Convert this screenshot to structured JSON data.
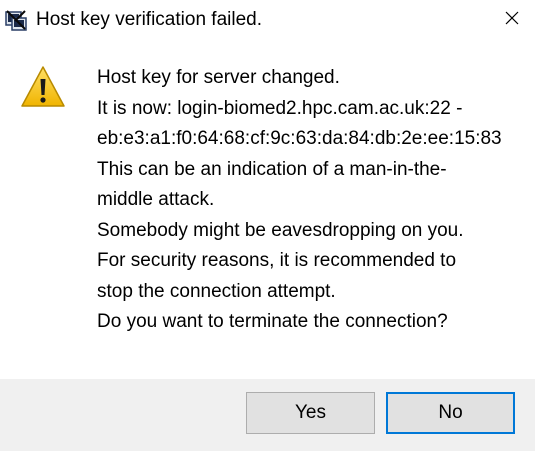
{
  "window": {
    "title": "Host key verification failed.",
    "app_icon": "putty-icon",
    "close_icon": "close-icon"
  },
  "dialog": {
    "icon": "warning-icon",
    "message_lines": [
      "Host key for server changed.",
      "It is now: login-biomed2.hpc.cam.ac.uk:22 -",
      "eb:e3:a1:f0:64:68:cf:9c:63:da:84:db:2e:ee:15:83",
      "This can be an indication of a man-in-the-",
      "middle attack.",
      "Somebody might be eavesdropping on you.",
      "For security reasons, it is recommended to",
      "stop the connection attempt.",
      "Do you want to terminate the connection?"
    ]
  },
  "buttons": {
    "yes_label": "Yes",
    "no_label": "No"
  },
  "colors": {
    "focus_border": "#0078d7",
    "footer_bg": "#f0f0f0",
    "button_bg": "#e1e1e1",
    "warning_yellow": "#f5c400"
  }
}
